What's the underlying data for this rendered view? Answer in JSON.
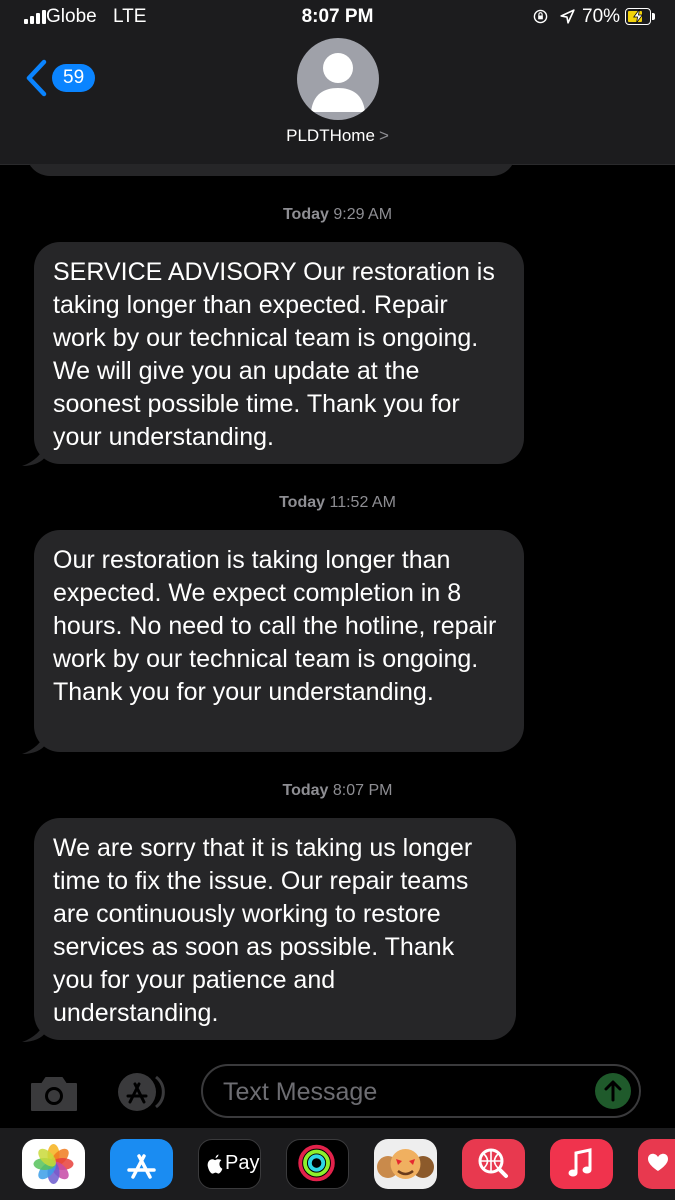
{
  "status_bar": {
    "carrier": "Globe",
    "network": "LTE",
    "time": "8:07 PM",
    "battery": "70%"
  },
  "header": {
    "back_count": "59",
    "contact_name": "PLDTHome",
    "contact_chevron": ">"
  },
  "messages": [
    {
      "stamp_day": "Today",
      "stamp_time": "9:29 AM",
      "text": "SERVICE ADVISORY  Our restoration is taking longer than expected. Repair work by our technical team is ongoing. We will give you an update at the soonest possible time. Thank you for your understanding."
    },
    {
      "stamp_day": "Today",
      "stamp_time": "11:52 AM",
      "text": "Our restoration is taking longer than expected. We expect completion in 8 hours. No need to call the hotline, repair work by our technical team is ongoing. Thank you for your understanding."
    },
    {
      "stamp_day": "Today",
      "stamp_time": "8:07 PM",
      "text": "We are sorry that it is taking us longer time to fix the issue. Our repair teams are continuously working to restore services as soon as possible. Thank you for your patience and understanding."
    }
  ],
  "composer": {
    "placeholder": "Text Message"
  },
  "app_drawer": {
    "apps": [
      "photos-icon",
      "app-store-icon",
      "apple-pay-icon",
      "activity-icon",
      "memoji-icon",
      "web-search-icon",
      "music-icon",
      "digital-touch-icon"
    ],
    "apple_pay_label": "Pay"
  },
  "colors": {
    "bubble": "#262628",
    "accent": "#0a84ff",
    "timestamp": "#8e8e93",
    "bar": "#1c1c1e"
  }
}
